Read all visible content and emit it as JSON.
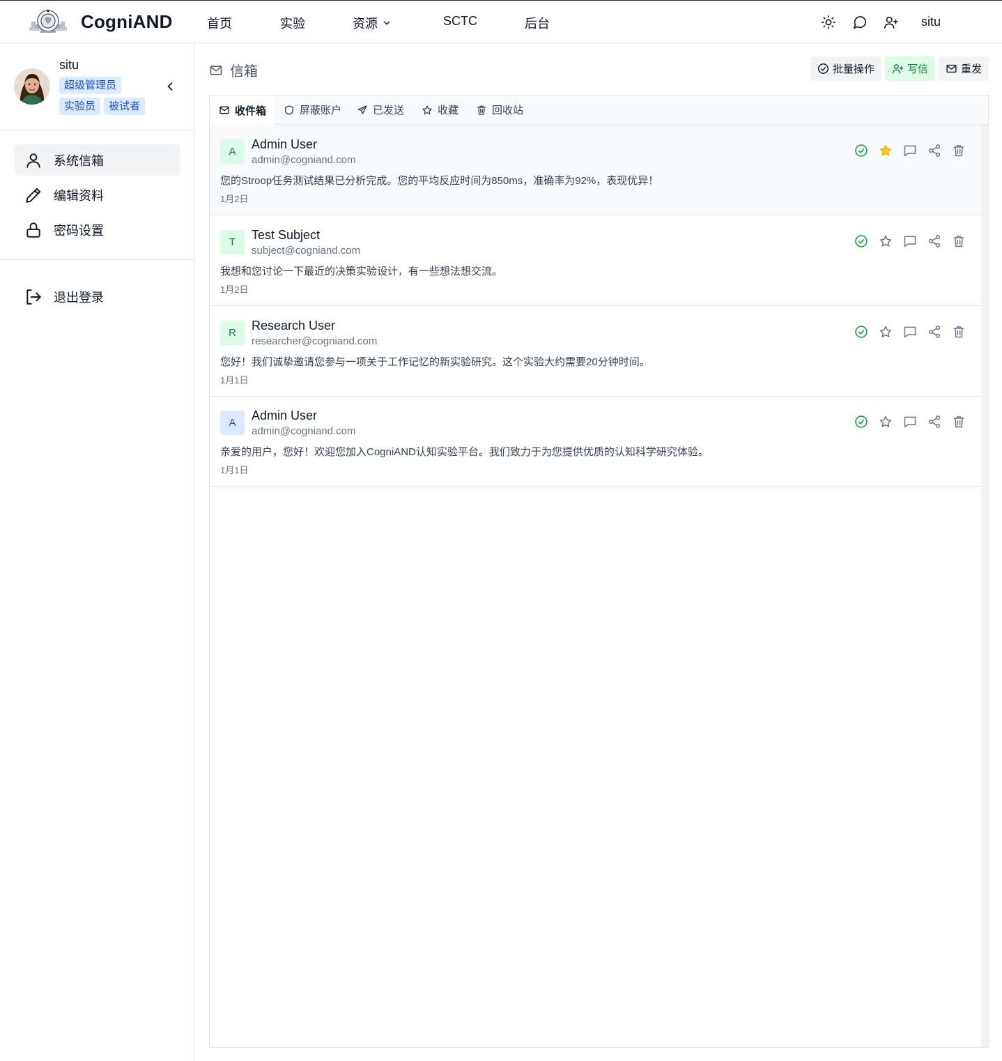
{
  "app": {
    "brand": "CogniAND",
    "nav": [
      {
        "label": "首页"
      },
      {
        "label": "实验"
      },
      {
        "label": "资源"
      },
      {
        "label": "SCTC"
      },
      {
        "label": "后台"
      }
    ],
    "username": "situ"
  },
  "sidebar": {
    "profile_name": "situ",
    "roles": [
      "超级管理员",
      "实验员",
      "被试者"
    ],
    "menu": [
      {
        "label": "系统信箱",
        "icon": "user-icon",
        "active": true
      },
      {
        "label": "编辑资料",
        "icon": "pencil-icon"
      },
      {
        "label": "密码设置",
        "icon": "lock-icon"
      }
    ],
    "logout_label": "退出登录"
  },
  "mailbox": {
    "title": "信箱",
    "actions": {
      "batch": "批量操作",
      "compose": "写信",
      "resend": "重发"
    },
    "tabs": [
      {
        "label": "收件箱",
        "icon": "mail-icon"
      },
      {
        "label": "屏蔽账户",
        "icon": "shield-icon"
      },
      {
        "label": "已发送",
        "icon": "send-icon"
      },
      {
        "label": "收藏",
        "icon": "star-icon"
      },
      {
        "label": "回收站",
        "icon": "trash-icon"
      }
    ],
    "messages": [
      {
        "initial": "A",
        "name": "Admin User",
        "email": "admin@cogniand.com",
        "body": "您的Stroop任务测试结果已分析完成。您的平均反应时间为850ms，准确率为92%，表现优异！",
        "date": "1月2日",
        "starred": true,
        "read": true
      },
      {
        "initial": "T",
        "name": "Test Subject",
        "email": "subject@cogniand.com",
        "body": "我想和您讨论一下最近的决策实验设计，有一些想法想交流。",
        "date": "1月2日",
        "starred": false,
        "read": true
      },
      {
        "initial": "R",
        "name": "Research User",
        "email": "researcher@cogniand.com",
        "body": "您好！我们诚挚邀请您参与一项关于工作记忆的新实验研究。这个实验大约需要20分钟时间。",
        "date": "1月1日",
        "starred": false,
        "read": true
      },
      {
        "initial": "A",
        "name": "Admin User",
        "email": "admin@cogniand.com",
        "body": "亲爱的用户，您好！欢迎您加入CogniAND认知实验平台。我们致力于为您提供优质的认知科学研究体验。",
        "date": "1月1日",
        "starred": false,
        "read": true
      }
    ]
  },
  "colors": {
    "accent_green": "#16a34a",
    "star_yellow": "#facc15",
    "badge_blue_bg": "#dbeafe",
    "badge_blue_text": "#1d4ed8",
    "compose_bg": "#dcfce7"
  }
}
